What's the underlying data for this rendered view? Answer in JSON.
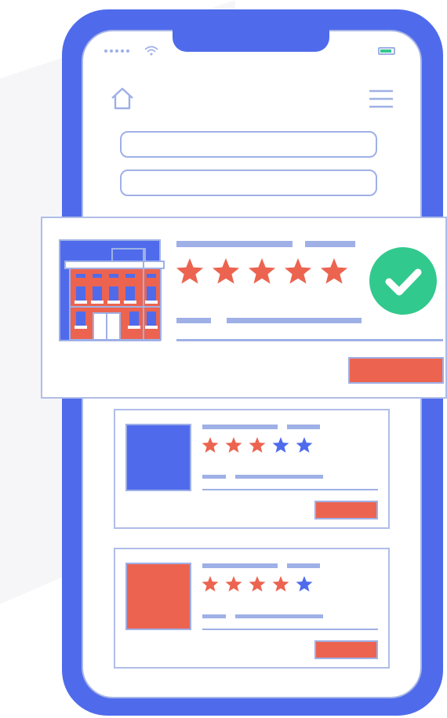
{
  "colors": {
    "phone": "#4f6bec",
    "outline": "#9fb0e6",
    "star_red": "#ec6450",
    "star_blue": "#4f6bec",
    "check_green": "#32c98e",
    "button": "#ec6450"
  },
  "icons": [
    "wifi-icon",
    "battery-icon",
    "home-icon",
    "menu-icon",
    "building-icon",
    "checkmark-icon",
    "star-icon"
  ],
  "featured_listing": {
    "rating": 5,
    "max_rating": 5,
    "verified": true
  },
  "listings": [
    {
      "thumbnail_color": "#4f6bec",
      "rating": 3,
      "max_rating": 5
    },
    {
      "thumbnail_color": "#ec6450",
      "rating": 4,
      "max_rating": 5
    }
  ]
}
